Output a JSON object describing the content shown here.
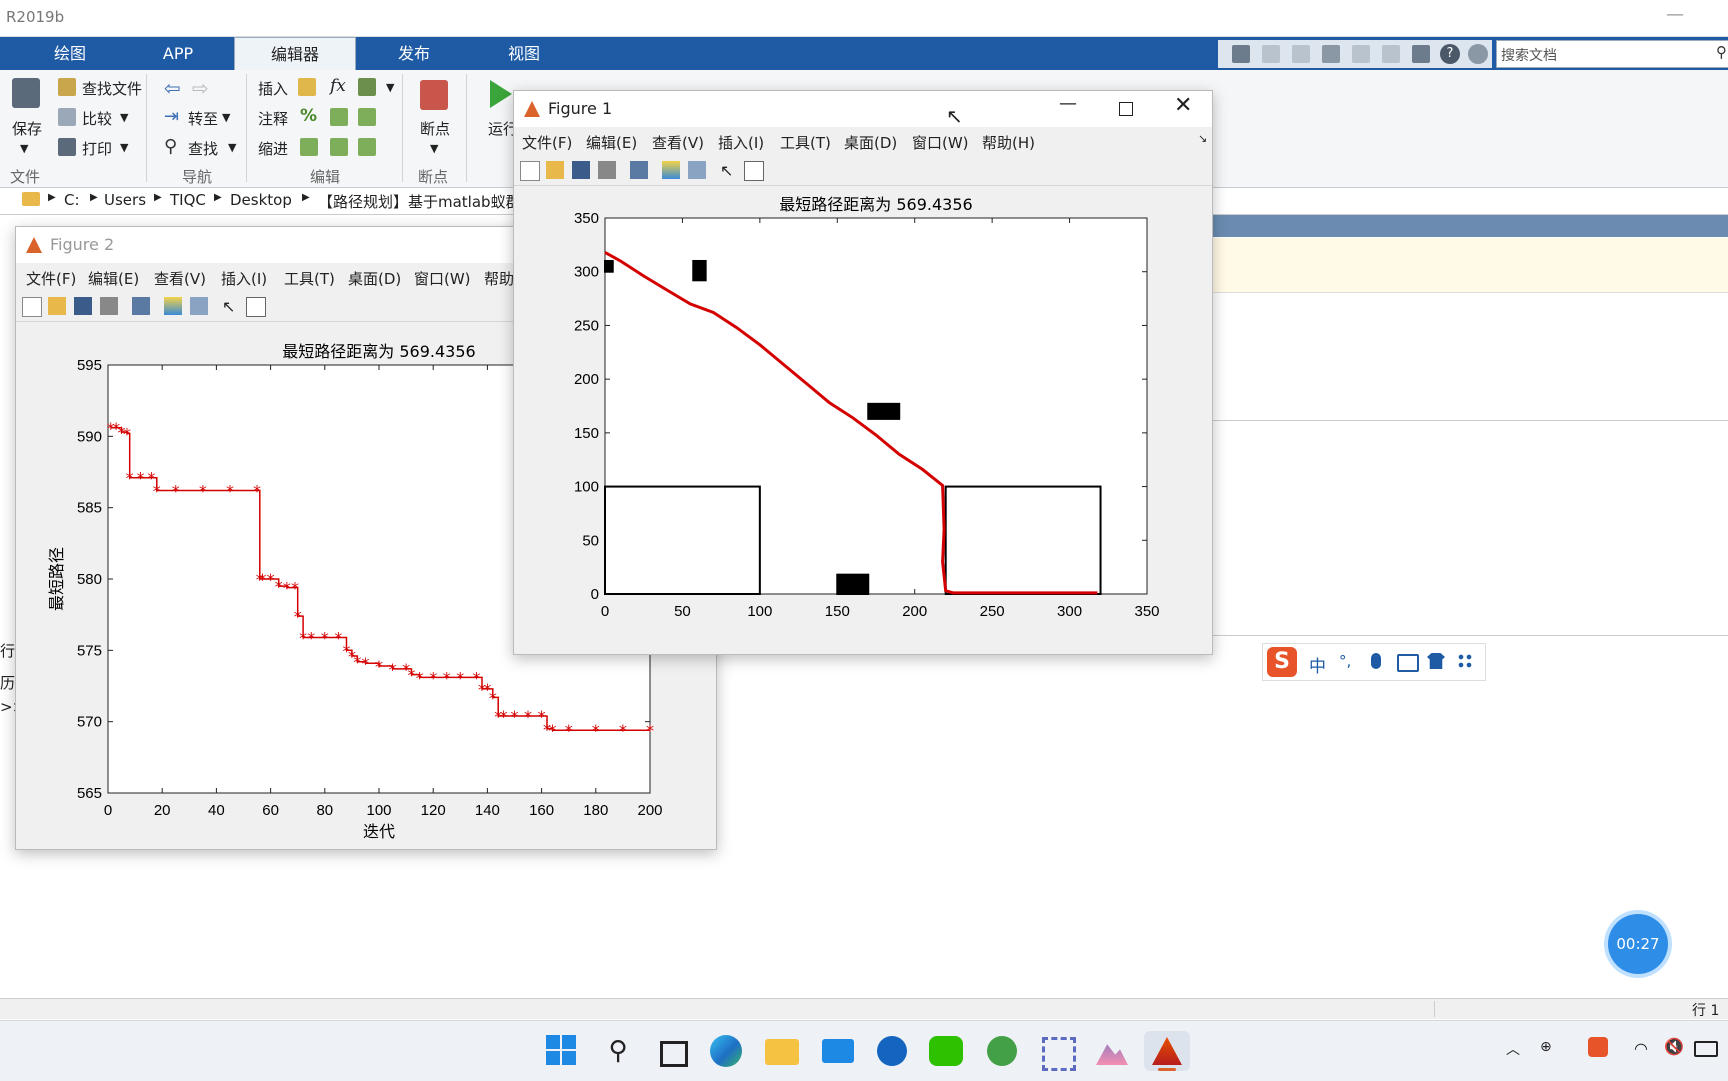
{
  "app": {
    "title": "R2019b"
  },
  "ribbon": {
    "tabs": [
      {
        "label": "绘图",
        "active": false
      },
      {
        "label": "APP",
        "active": false
      },
      {
        "label": "编辑器",
        "active": true
      },
      {
        "label": "发布",
        "active": false
      },
      {
        "label": "视图",
        "active": false
      }
    ],
    "file": {
      "save": "保存",
      "find_files": "查找文件",
      "compare": "比较",
      "print": "打印",
      "group": "文件"
    },
    "navigate": {
      "goto": "转至",
      "find": "查找",
      "group": "导航"
    },
    "edit": {
      "insert": "插入",
      "comment": "注释",
      "indent": "缩进",
      "group": "编辑",
      "fx": "fx",
      "percent": "%"
    },
    "breakpoints": {
      "label": "断点",
      "group": "断点"
    },
    "run": {
      "label": "运行"
    }
  },
  "search": {
    "placeholder": "搜索文档"
  },
  "path": {
    "segments": [
      "C:",
      "Users",
      "TIQC",
      "Desktop",
      "【路径规划】基于matlab蚁群"
    ]
  },
  "side_fragments": [
    "行",
    "历",
    ">>"
  ],
  "status": {
    "right": "行 1"
  },
  "timer": {
    "text": "00:27"
  },
  "figure1": {
    "title": "Figure 1",
    "menu": [
      "文件(F)",
      "编辑(E)",
      "查看(V)",
      "插入(I)",
      "工具(T)",
      "桌面(D)",
      "窗口(W)",
      "帮助(H)"
    ],
    "accent": "#d40000"
  },
  "figure2": {
    "title": "Figure 2",
    "menu": [
      "文件(F)",
      "编辑(E)",
      "查看(V)",
      "插入(I)",
      "工具(T)",
      "桌面(D)",
      "窗口(W)",
      "帮助"
    ]
  },
  "ime": {
    "chinese": "中",
    "punct": "°,"
  },
  "chart_data": [
    {
      "type": "line",
      "title": "最短路径距离为 569.4356",
      "xlabel": "",
      "ylabel": "",
      "xlim": [
        0,
        350
      ],
      "ylim": [
        0,
        350
      ],
      "xticks": [
        0,
        50,
        100,
        150,
        200,
        250,
        300,
        350
      ],
      "yticks": [
        0,
        50,
        100,
        150,
        200,
        250,
        300,
        350
      ],
      "grid": false,
      "series": [
        {
          "x": [
            0,
            10,
            25,
            40,
            55,
            70,
            85,
            100,
            115,
            130,
            145,
            160,
            175,
            190,
            205,
            218,
            219,
            218,
            220,
            225,
            240,
            260,
            280,
            300,
            318
          ],
          "y": [
            318,
            310,
            296,
            283,
            270,
            262,
            248,
            232,
            214,
            196,
            178,
            164,
            148,
            130,
            116,
            101,
            60,
            30,
            3,
            1,
            1,
            1,
            1,
            1,
            1
          ]
        }
      ],
      "obstacles": [
        {
          "x": [
            0,
            100
          ],
          "y": [
            0,
            100
          ]
        },
        {
          "x": [
            220,
            320
          ],
          "y": [
            0,
            100
          ]
        },
        {
          "x": [
            150,
            170
          ],
          "y": [
            0,
            18
          ]
        },
        {
          "x": [
            57,
            65
          ],
          "y": [
            292,
            310
          ]
        },
        {
          "x": [
            170,
            190
          ],
          "y": [
            163,
            177
          ]
        },
        {
          "x": [
            0,
            5
          ],
          "y": [
            300,
            310
          ]
        }
      ]
    },
    {
      "type": "line",
      "title": "最短路径距离为 569.4356",
      "xlabel": "迭代",
      "ylabel": "最短路径",
      "xlim": [
        0,
        200
      ],
      "ylim": [
        565,
        595
      ],
      "xticks": [
        0,
        20,
        40,
        60,
        80,
        100,
        120,
        140,
        160,
        180,
        200
      ],
      "yticks": [
        565,
        570,
        575,
        580,
        585,
        590,
        595
      ],
      "marker": "*",
      "series": [
        {
          "x": [
            1,
            3,
            5,
            7,
            8,
            12,
            16,
            18,
            25,
            35,
            45,
            55,
            56,
            57,
            60,
            63,
            66,
            69,
            70,
            72,
            75,
            80,
            85,
            88,
            90,
            92,
            95,
            100,
            105,
            110,
            112,
            115,
            120,
            125,
            130,
            136,
            138,
            140,
            142,
            144,
            146,
            150,
            155,
            160,
            162,
            164,
            170,
            180,
            190,
            200
          ],
          "y": [
            590.6,
            590.6,
            590.3,
            590.2,
            587.1,
            587.1,
            587.1,
            586.2,
            586.2,
            586.2,
            586.2,
            586.2,
            580.0,
            580.0,
            580.0,
            579.5,
            579.4,
            579.4,
            577.4,
            575.9,
            575.9,
            575.9,
            575.9,
            575.0,
            574.6,
            574.2,
            574.1,
            573.9,
            573.7,
            573.7,
            573.3,
            573.1,
            573.1,
            573.1,
            573.1,
            573.1,
            572.3,
            572.3,
            571.7,
            570.4,
            570.4,
            570.4,
            570.4,
            570.4,
            569.5,
            569.4,
            569.4,
            569.4,
            569.4,
            569.4
          ]
        }
      ]
    }
  ]
}
